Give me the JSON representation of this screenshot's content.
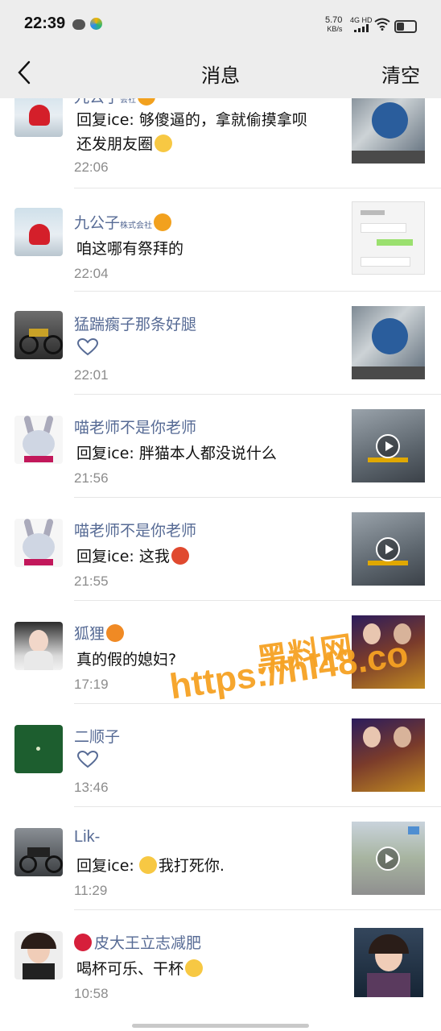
{
  "status_bar": {
    "time": "22:39",
    "speed": "5.70",
    "speed_unit": "KB/s",
    "network": "4G HD"
  },
  "nav": {
    "title": "消息",
    "clear_label": "清空"
  },
  "messages": [
    {
      "name": "九公子",
      "badge_text": "会社",
      "reply_prefix": "回复ice: ",
      "text": "够傻逼的，拿就偷摸拿呗",
      "text2": "还发朋友圈",
      "time": "22:06",
      "thumb": "photo"
    },
    {
      "name": "九公子",
      "badge_text": "株式会社",
      "text": "咱这哪有祭拜的",
      "time": "22:04",
      "thumb": "chat-screenshot"
    },
    {
      "name": "猛踹瘸子那条好腿",
      "like": true,
      "time": "22:01",
      "thumb": "photo"
    },
    {
      "name": "喵老师不是你老师",
      "reply_prefix": "回复ice: ",
      "text": "胖猫本人都没说什么",
      "time": "21:56",
      "thumb": "video"
    },
    {
      "name": "喵老师不是你老师",
      "reply_prefix": "回复ice: ",
      "text": "这我",
      "time": "21:55",
      "thumb": "video"
    },
    {
      "name": "狐狸",
      "text": "真的假的媳妇?",
      "time": "17:19",
      "thumb": "photo"
    },
    {
      "name": "二顺子",
      "like": true,
      "time": "13:46",
      "thumb": "photo"
    },
    {
      "name": "Lik-",
      "reply_prefix": "回复ice: ",
      "text": "我打死你.",
      "time": "11:29",
      "thumb": "video"
    },
    {
      "name": "皮大王立志减肥",
      "text": "喝杯可乐、干杯",
      "time": "10:58",
      "thumb": "photo"
    }
  ],
  "watermark": {
    "line1": "黑料网",
    "line2": "https://hl48.co"
  },
  "colors": {
    "name": "#576b95",
    "time": "#8c8c8c",
    "bar_bg": "#ededed",
    "watermark": "#f6a223"
  }
}
